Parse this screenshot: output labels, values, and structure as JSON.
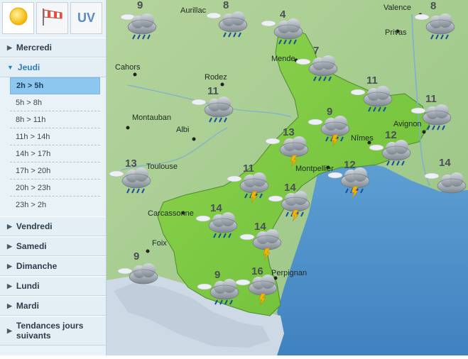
{
  "sidebar": {
    "tabs": [
      {
        "icon": "sun-icon",
        "label": ""
      },
      {
        "icon": "windsock-icon",
        "label": ""
      },
      {
        "icon": "uv-icon",
        "label": "UV"
      }
    ],
    "days": {
      "mercredi": "Mercredi",
      "jeudi": "Jeudi",
      "vendredi": "Vendredi",
      "samedi": "Samedi",
      "dimanche": "Dimanche",
      "lundi": "Lundi",
      "mardi": "Mardi",
      "tendances": "Tendances jours suivants"
    },
    "time_slots": [
      "2h > 5h",
      "5h > 8h",
      "8h > 11h",
      "11h > 14h",
      "14h > 17h",
      "17h > 20h",
      "20h > 23h",
      "23h > 2h"
    ],
    "selected_slot": "2h > 5h"
  },
  "map": {
    "cities": {
      "aurillac": "Aurillac",
      "valence": "Valence",
      "privas": "Privas",
      "cahors": "Cahors",
      "rodez": "Rodez",
      "mende": "Mende",
      "montauban": "Montauban",
      "albi": "Albi",
      "avignon": "Avignon",
      "nimes": "Nîmes",
      "toulouse": "Toulouse",
      "montpellier": "Montpellier",
      "carcassonne": "Carcassonne",
      "foix": "Foix",
      "perpignan": "Perpignan"
    },
    "forecasts": {
      "t1": {
        "temp": "9",
        "icon": "rain-cloud-icon"
      },
      "t2": {
        "temp": "8",
        "icon": "rain-cloud-icon"
      },
      "t3": {
        "temp": "4",
        "icon": "rain-cloud-icon"
      },
      "t4": {
        "temp": "8",
        "icon": "rain-cloud-icon"
      },
      "t5": {
        "temp": "7",
        "icon": "rain-cloud-icon"
      },
      "t6": {
        "temp": "11",
        "icon": "rain-cloud-icon"
      },
      "t7": {
        "temp": "11",
        "icon": "rain-cloud-icon"
      },
      "t8": {
        "temp": "11",
        "icon": "rain-cloud-icon"
      },
      "t9": {
        "temp": "9",
        "icon": "storm-rain-icon"
      },
      "t10": {
        "temp": "13",
        "icon": "storm-icon"
      },
      "t11": {
        "temp": "12",
        "icon": "rain-cloud-icon"
      },
      "t12": {
        "temp": "13",
        "icon": "rain-cloud-icon"
      },
      "t13": {
        "temp": "11",
        "icon": "storm-rain-icon"
      },
      "t14": {
        "temp": "12",
        "icon": "storm-rain-icon"
      },
      "t15": {
        "temp": "14",
        "icon": "cloud-icon"
      },
      "t16": {
        "temp": "14",
        "icon": "storm-rain-icon"
      },
      "t17": {
        "temp": "14",
        "icon": "rain-cloud-icon"
      },
      "t18": {
        "temp": "14",
        "icon": "storm-icon"
      },
      "t19": {
        "temp": "9",
        "icon": "cloud-icon"
      },
      "t20": {
        "temp": "16",
        "icon": "storm-icon"
      },
      "t21": {
        "temp": "9",
        "icon": "rain-cloud-icon"
      }
    },
    "colors": {
      "region": "#7cc944",
      "land": "#a8cf90",
      "sea": "#4a90c8",
      "mountain": "#c9d8e3"
    }
  }
}
